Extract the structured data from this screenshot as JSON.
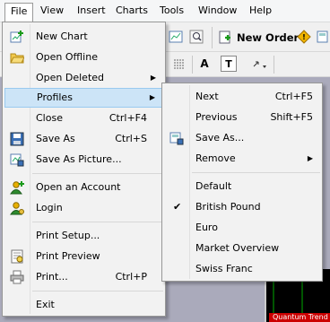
{
  "menubar": {
    "items": [
      "File",
      "View",
      "Insert",
      "Charts",
      "Tools",
      "Window",
      "Help"
    ]
  },
  "toolbar": {
    "new_order": "New Order",
    "font_glyph": "A",
    "text_glyph": "T"
  },
  "chart": {
    "tab_label": "Quantum Trend"
  },
  "file_menu": {
    "items": [
      {
        "label": "New Chart",
        "shortcut": "",
        "icon": "new-chart-icon"
      },
      {
        "label": "Open Offline",
        "shortcut": "",
        "icon": "folder-icon"
      },
      {
        "label": "Open Deleted",
        "shortcut": "",
        "submenu": true
      },
      {
        "label": "Profiles",
        "shortcut": "",
        "submenu": true,
        "highlighted": true
      },
      {
        "label": "Close",
        "shortcut": "Ctrl+F4"
      },
      {
        "label": "Save As",
        "shortcut": "Ctrl+S",
        "icon": "save-icon"
      },
      {
        "label": "Save As Picture...",
        "shortcut": "",
        "icon": "save-picture-icon"
      },
      {
        "label": "Open an Account",
        "shortcut": "",
        "icon": "add-user-icon"
      },
      {
        "label": "Login",
        "shortcut": "",
        "icon": "login-icon"
      },
      {
        "label": "Print Setup...",
        "shortcut": ""
      },
      {
        "label": "Print Preview",
        "shortcut": "",
        "icon": "print-preview-icon"
      },
      {
        "label": "Print...",
        "shortcut": "Ctrl+P",
        "icon": "printer-icon"
      },
      {
        "label": "Exit",
        "shortcut": ""
      }
    ]
  },
  "profiles_menu": {
    "items": [
      {
        "label": "Next",
        "shortcut": "Ctrl+F5"
      },
      {
        "label": "Previous",
        "shortcut": "Shift+F5"
      },
      {
        "label": "Save As...",
        "shortcut": "",
        "icon": "save-profile-icon"
      },
      {
        "label": "Remove",
        "shortcut": "",
        "submenu": true
      },
      {
        "label": "Default",
        "shortcut": ""
      },
      {
        "label": "British Pound",
        "shortcut": "",
        "checked": true
      },
      {
        "label": "Euro",
        "shortcut": ""
      },
      {
        "label": "Market Overview",
        "shortcut": ""
      },
      {
        "label": "Swiss Franc",
        "shortcut": ""
      }
    ]
  },
  "glyphs": {
    "submenu_arrow": "▶",
    "check": "✔"
  }
}
